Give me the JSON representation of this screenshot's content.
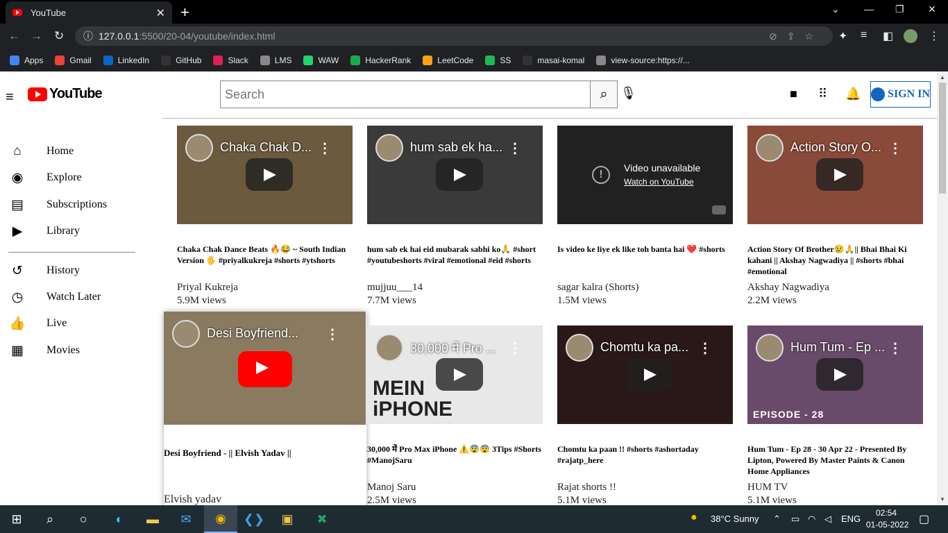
{
  "browser": {
    "tab_title": "YouTube",
    "tab_close": "✕",
    "new_tab": "+",
    "window_controls": [
      "⌄",
      "—",
      "❐",
      "✕"
    ],
    "url_host": "127.0.0.1",
    "url_path": ":5500/20-04/youtube/index.html",
    "bookmarks": [
      {
        "label": "Apps",
        "color": "#4285f4"
      },
      {
        "label": "Gmail",
        "color": "#ea4335"
      },
      {
        "label": "LinkedIn",
        "color": "#0a66c2"
      },
      {
        "label": "GitHub",
        "color": "#333333"
      },
      {
        "label": "Slack",
        "color": "#e01e5a"
      },
      {
        "label": "LMS",
        "color": "#888888"
      },
      {
        "label": "WAW",
        "color": "#25d366"
      },
      {
        "label": "HackerRank",
        "color": "#1ba94c"
      },
      {
        "label": "LeetCode",
        "color": "#ffa116"
      },
      {
        "label": "SS",
        "color": "#1db954"
      },
      {
        "label": "masai-komal",
        "color": "#333333"
      },
      {
        "label": "view-source:https://...",
        "color": "#888888"
      }
    ]
  },
  "header": {
    "logo_text": "YouTube",
    "search_placeholder": "Search",
    "signin_label": "SIGN IN"
  },
  "sidebar": {
    "items": [
      {
        "label": "Home",
        "icon": "home-icon",
        "glyph": "⌂"
      },
      {
        "label": "Explore",
        "icon": "compass-icon",
        "glyph": "◉"
      },
      {
        "label": "Subscriptions",
        "icon": "subscriptions-icon",
        "glyph": "▤"
      },
      {
        "label": "Library",
        "icon": "library-icon",
        "glyph": "▶"
      },
      {
        "label": "History",
        "icon": "history-icon",
        "glyph": "↺"
      },
      {
        "label": "Watch Later",
        "icon": "clock-icon",
        "glyph": "◷"
      },
      {
        "label": "Live",
        "icon": "thumbs-up-icon",
        "glyph": "👍"
      },
      {
        "label": "Movies",
        "icon": "film-icon",
        "glyph": "▦"
      }
    ]
  },
  "videos": [
    {
      "thumb_title": "Chaka Chak D...",
      "title": "Chaka Chak Dance Beats 🔥😂 ~ South Indian Version 🖐 #priyalkukreja #shorts #ytshorts",
      "channel": "Priyal Kukreja",
      "views": "5.9M views",
      "bg": "#6b5a3e"
    },
    {
      "thumb_title": "hum sab ek ha...",
      "title": "hum sab ek hai eid mubarak sabhi ko🙏 #short #youtubeshorts #viral #emotional #eid #shorts",
      "channel": "mujjuu___14",
      "views": "7.7M views",
      "bg": "#3a3a3a"
    },
    {
      "thumb_title": "",
      "title": "Is video ke liye ek like toh banta hai ❤️ #shorts",
      "channel": "sagar kalra (Shorts)",
      "views": "1.5M views",
      "bg": "#212121",
      "unavailable": "Video unavailable",
      "watch_link": "Watch on YouTube"
    },
    {
      "thumb_title": "Action Story O...",
      "title": "Action Story Of Brother😢🙏|| Bhai Bhai Ki kahani || Akshay Nagwadiya || #shorts #bhai #emotional",
      "channel": "Akshay Nagwadiya",
      "views": "2.2M views",
      "bg": "#8a4a3a"
    },
    {
      "thumb_title": "Desi Boyfriend...",
      "title": "Desi Boyfriend - || Elvish Yadav ||",
      "channel": "Elvish yadav",
      "views": "",
      "bg": "#8a7a60"
    },
    {
      "thumb_title": "30,000 में Pro ...",
      "title": "30,000 में Pro Max iPhone ⚠️😨😨 3Tips #Shorts #ManojSaru",
      "channel": "Manoj Saru",
      "views": "2.5M views",
      "bg": "#e8e8e8",
      "thumb_text": "MEIN\niPHONE"
    },
    {
      "thumb_title": "Chomtu ka pa...",
      "title": "Chomtu ka paan !! #shorts #ashortaday #rajatp_here",
      "channel": "Rajat shorts !!",
      "views": "5.1M views",
      "bg": "#2a1818"
    },
    {
      "thumb_title": "Hum Tum - Ep ...",
      "title": "Hum Tum - Ep 28 - 30 Apr 22 - Presented By Lipton, Powered By Master Paints & Canon Home Appliances",
      "channel": "HUM TV",
      "views": "5.1M views",
      "bg": "#6a4a6a",
      "thumb_text": "EPISODE - 28"
    }
  ],
  "taskbar": {
    "weather": "38°C  Sunny",
    "lang": "ENG",
    "time": "02:54",
    "date": "01-05-2022"
  },
  "colors": {
    "accent": "#ff0000",
    "signin": "#1565c0",
    "chrome_dark": "#202124"
  }
}
